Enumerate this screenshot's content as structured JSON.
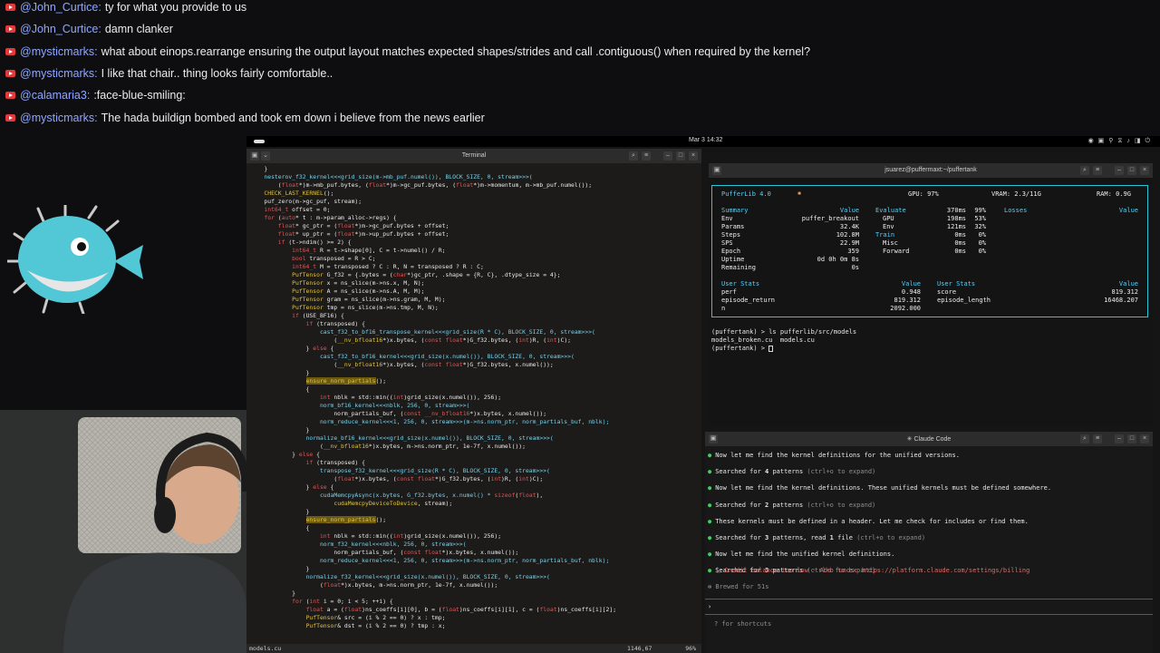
{
  "chat": [
    {
      "user": "@John_Curtice:",
      "message": "ty for what you provide to us"
    },
    {
      "user": "@John_Curtice:",
      "message": "damn clanker"
    },
    {
      "user": "@mysticmarks:",
      "message": "what about einops.rearrange ensuring the output layout matches expected shapes/strides and call .contiguous() when required by the kernel?"
    },
    {
      "user": "@mysticmarks:",
      "message": "I like that chair.. thing looks fairly comfortable.."
    },
    {
      "user": "@calamaria3:",
      "message": ":face-blue-smiling:"
    },
    {
      "user": "@mysticmarks:",
      "message": "The hada buildign bombed and took em down i believe from the news earlier"
    }
  ],
  "colors": {
    "chat_user": "#8fa7ff",
    "accent_cyan": "#29c7d9",
    "keyword": "#e05555",
    "type": "#e0c240",
    "green_dot": "#3fcf5e",
    "warn": "#e06a6a"
  },
  "topbar": {
    "clock": "Mar 3 14:32",
    "tray_icons": [
      "color-wheel-icon",
      "display-icon",
      "network-icon",
      "volume-icon",
      "battery-icon",
      "power-icon"
    ]
  },
  "editor": {
    "window_title": "Terminal",
    "status_file": "models.cu",
    "status_position": "1146,67",
    "status_percent": "96%",
    "code": [
      [
        {
          "t": "    }"
        }
      ],
      [
        {
          "t": "    "
        },
        {
          "t": "nesterov_f32_kernel<<<grid_size(m->mb_puf.numel()), BLOCK_SIZE, 0, stream>>>(",
          "c": "fn"
        }
      ],
      [
        {
          "t": "        ("
        },
        {
          "t": "float",
          "c": "kw"
        },
        {
          "t": "*)m->mb_puf.bytes, ("
        },
        {
          "t": "float",
          "c": "kw"
        },
        {
          "t": "*)m->gc_puf.bytes, ("
        },
        {
          "t": "float",
          "c": "kw"
        },
        {
          "t": "*)m->momentum, m->mb_puf.numel());"
        }
      ],
      [
        {
          "t": "    "
        },
        {
          "t": "CHECK_LAST_KERNEL",
          "c": "ty"
        },
        {
          "t": "();"
        }
      ],
      [
        {
          "t": "    puf_zero(m->gc_puf, stream);"
        }
      ],
      [
        {
          "t": "    "
        },
        {
          "t": "int64_t",
          "c": "kw"
        },
        {
          "t": " offset = 0;"
        }
      ],
      [
        {
          "t": "    "
        },
        {
          "t": "for",
          "c": "kw"
        },
        {
          "t": " ("
        },
        {
          "t": "auto",
          "c": "kw"
        },
        {
          "t": "* t : m->param_alloc->regs) {"
        }
      ],
      [
        {
          "t": "        "
        },
        {
          "t": "float",
          "c": "kw"
        },
        {
          "t": "* gc_ptr = ("
        },
        {
          "t": "float",
          "c": "kw"
        },
        {
          "t": "*)m->gc_puf.bytes + offset;"
        }
      ],
      [
        {
          "t": "        "
        },
        {
          "t": "float",
          "c": "kw"
        },
        {
          "t": "* up_ptr = ("
        },
        {
          "t": "float",
          "c": "kw"
        },
        {
          "t": "*)m->up_puf.bytes + offset;"
        }
      ],
      [
        {
          "t": "        "
        },
        {
          "t": "if",
          "c": "kw"
        },
        {
          "t": " (t->ndim() >= 2) {"
        }
      ],
      [
        {
          "t": "            "
        },
        {
          "t": "int64_t",
          "c": "kw"
        },
        {
          "t": " R = t->shape[0], C = t->numel() / R;"
        }
      ],
      [
        {
          "t": "            "
        },
        {
          "t": "bool",
          "c": "kw"
        },
        {
          "t": " transposed = R > C;"
        }
      ],
      [
        {
          "t": "            "
        },
        {
          "t": "int64_t",
          "c": "kw"
        },
        {
          "t": " M = transposed ? C : R, N = transposed ? R : C;"
        }
      ],
      [
        {
          "t": "            "
        },
        {
          "t": "PufTensor",
          "c": "ty"
        },
        {
          "t": " G_f32 = {.bytes = ("
        },
        {
          "t": "char",
          "c": "kw"
        },
        {
          "t": "*)gc_ptr, .shape = {R, C}, .dtype_size = 4};"
        }
      ],
      [
        {
          "t": "            "
        },
        {
          "t": "PufTensor",
          "c": "ty"
        },
        {
          "t": " x = ns_slice(m->ns.x, M, N);"
        }
      ],
      [
        {
          "t": "            "
        },
        {
          "t": "PufTensor",
          "c": "ty"
        },
        {
          "t": " A = ns_slice(m->ns.A, M, M);"
        }
      ],
      [
        {
          "t": "            "
        },
        {
          "t": "PufTensor",
          "c": "ty"
        },
        {
          "t": " gram = ns_slice(m->ns.gram, M, M);"
        }
      ],
      [
        {
          "t": "            "
        },
        {
          "t": "PufTensor",
          "c": "ty"
        },
        {
          "t": " tmp = ns_slice(m->ns.tmp, M, N);"
        }
      ],
      [
        {
          "t": "            "
        },
        {
          "t": "if",
          "c": "kw"
        },
        {
          "t": " (USE_BF16) {"
        }
      ],
      [
        {
          "t": "                "
        },
        {
          "t": "if",
          "c": "kw"
        },
        {
          "t": " (transposed) {"
        }
      ],
      [
        {
          "t": "                    "
        },
        {
          "t": "cast_f32_to_bf16_transpose_kernel<<<grid_size(R * C), BLOCK_SIZE, 0, stream>>>(",
          "c": "fn"
        }
      ],
      [
        {
          "t": "                        ("
        },
        {
          "t": "__nv_bfloat16",
          "c": "ty"
        },
        {
          "t": "*)x.bytes, ("
        },
        {
          "t": "const float",
          "c": "kw"
        },
        {
          "t": "*)G_f32.bytes, ("
        },
        {
          "t": "int",
          "c": "kw"
        },
        {
          "t": ")R, ("
        },
        {
          "t": "int",
          "c": "kw"
        },
        {
          "t": ")C);"
        }
      ],
      [
        {
          "t": "                } "
        },
        {
          "t": "else",
          "c": "kw"
        },
        {
          "t": " {"
        }
      ],
      [
        {
          "t": "                    "
        },
        {
          "t": "cast_f32_to_bf16_kernel<<<grid_size(x.numel()), BLOCK_SIZE, 0, stream>>>(",
          "c": "fn"
        }
      ],
      [
        {
          "t": "                        ("
        },
        {
          "t": "__nv_bfloat16",
          "c": "ty"
        },
        {
          "t": "*)x.bytes, ("
        },
        {
          "t": "const float",
          "c": "kw"
        },
        {
          "t": "*)G_f32.bytes, x.numel());"
        }
      ],
      [
        {
          "t": "                }"
        }
      ],
      [
        {
          "t": "                "
        },
        {
          "t": "ensure_norm_partials",
          "c": "hl"
        },
        {
          "t": "();"
        }
      ],
      [
        {
          "t": "                {"
        }
      ],
      [
        {
          "t": "                    "
        },
        {
          "t": "int",
          "c": "kw"
        },
        {
          "t": " nblk = std::min(("
        },
        {
          "t": "int",
          "c": "kw"
        },
        {
          "t": ")grid_size(x.numel()), 256);"
        }
      ],
      [
        {
          "t": "                    "
        },
        {
          "t": "norm_bf16_kernel<<<nblk, 256, 0, stream>>>(",
          "c": "fn"
        }
      ],
      [
        {
          "t": "                        norm_partials_buf, ("
        },
        {
          "t": "const __nv_bfloat16",
          "c": "kw"
        },
        {
          "t": "*)x.bytes, x.numel());"
        }
      ],
      [
        {
          "t": "                    "
        },
        {
          "t": "norm_reduce_kernel<<<1, 256, 0, stream>>>(m->ns.norm_ptr, norm_partials_buf, nblk);",
          "c": "fn"
        }
      ],
      [
        {
          "t": "                }"
        }
      ],
      [
        {
          "t": "                "
        },
        {
          "t": "normalize_bf16_kernel<<<grid_size(x.numel()), BLOCK_SIZE, 0, stream>>>(",
          "c": "fn"
        }
      ],
      [
        {
          "t": "                    ("
        },
        {
          "t": "__nv_bfloat16",
          "c": "ty"
        },
        {
          "t": "*)x.bytes, m->ns.norm_ptr, 1e-7f, x.numel());"
        }
      ],
      [
        {
          "t": "            } "
        },
        {
          "t": "else",
          "c": "kw"
        },
        {
          "t": " {"
        }
      ],
      [
        {
          "t": "                "
        },
        {
          "t": "if",
          "c": "kw"
        },
        {
          "t": " (transposed) {"
        }
      ],
      [
        {
          "t": "                    "
        },
        {
          "t": "transpose_f32_kernel<<<grid_size(R * C), BLOCK_SIZE, 0, stream>>>(",
          "c": "fn"
        }
      ],
      [
        {
          "t": "                        ("
        },
        {
          "t": "float",
          "c": "kw"
        },
        {
          "t": "*)x.bytes, ("
        },
        {
          "t": "const float",
          "c": "kw"
        },
        {
          "t": "*)G_f32.bytes, ("
        },
        {
          "t": "int",
          "c": "kw"
        },
        {
          "t": ")R, ("
        },
        {
          "t": "int",
          "c": "kw"
        },
        {
          "t": ")C);"
        }
      ],
      [
        {
          "t": "                } "
        },
        {
          "t": "else",
          "c": "kw"
        },
        {
          "t": " {"
        }
      ],
      [
        {
          "t": "                    "
        },
        {
          "t": "cudaMemcpyAsync(x.bytes, G_f32.bytes, x.numel() * ",
          "c": "fn"
        },
        {
          "t": "sizeof",
          "c": "kw"
        },
        {
          "t": "("
        },
        {
          "t": "float",
          "c": "kw"
        },
        {
          "t": "),"
        }
      ],
      [
        {
          "t": "                        "
        },
        {
          "t": "cudaMemcpyDeviceToDevice",
          "c": "ty"
        },
        {
          "t": ", stream);"
        }
      ],
      [
        {
          "t": "                }"
        }
      ],
      [
        {
          "t": "                "
        },
        {
          "t": "ensure_norm_partials",
          "c": "hl"
        },
        {
          "t": "();"
        }
      ],
      [
        {
          "t": "                {"
        }
      ],
      [
        {
          "t": "                    "
        },
        {
          "t": "int",
          "c": "kw"
        },
        {
          "t": " nblk = std::min(("
        },
        {
          "t": "int",
          "c": "kw"
        },
        {
          "t": ")grid_size(x.numel()), 256);"
        }
      ],
      [
        {
          "t": "                    "
        },
        {
          "t": "norm_f32_kernel<<<nblk, 256, 0, stream>>>(",
          "c": "fn"
        }
      ],
      [
        {
          "t": "                        norm_partials_buf, ("
        },
        {
          "t": "const float",
          "c": "kw"
        },
        {
          "t": "*)x.bytes, x.numel());"
        }
      ],
      [
        {
          "t": "                    "
        },
        {
          "t": "norm_reduce_kernel<<<1, 256, 0, stream>>>(m->ns.norm_ptr, norm_partials_buf, nblk);",
          "c": "fn"
        }
      ],
      [
        {
          "t": "                }"
        }
      ],
      [
        {
          "t": "                "
        },
        {
          "t": "normalize_f32_kernel<<<grid_size(x.numel()), BLOCK_SIZE, 0, stream>>>(",
          "c": "fn"
        }
      ],
      [
        {
          "t": "                    ("
        },
        {
          "t": "float",
          "c": "kw"
        },
        {
          "t": "*)x.bytes, m->ns.norm_ptr, 1e-7f, x.numel());"
        }
      ],
      [
        {
          "t": "            }"
        }
      ],
      [
        {
          "t": "            "
        },
        {
          "t": "for",
          "c": "kw"
        },
        {
          "t": " ("
        },
        {
          "t": "int",
          "c": "kw"
        },
        {
          "t": " i = 0; i < 5; ++i) {"
        }
      ],
      [
        {
          "t": "                "
        },
        {
          "t": "float",
          "c": "kw"
        },
        {
          "t": " a = ("
        },
        {
          "t": "float",
          "c": "kw"
        },
        {
          "t": ")ns_coeffs[i][0], b = ("
        },
        {
          "t": "float",
          "c": "kw"
        },
        {
          "t": ")ns_coeffs[i][1], c = ("
        },
        {
          "t": "float",
          "c": "kw"
        },
        {
          "t": ")ns_coeffs[i][2];"
        }
      ],
      [
        {
          "t": "                "
        },
        {
          "t": "PufTensor",
          "c": "ty"
        },
        {
          "t": "& src = (i % 2 == 0) ? x : tmp;"
        }
      ],
      [
        {
          "t": "                "
        },
        {
          "t": "PufTensor",
          "c": "ty"
        },
        {
          "t": "& dst = (i % 2 == 0) ? tmp : x;"
        }
      ]
    ]
  },
  "puffer": {
    "window_title": "jsuarez@puffermaxt:~/puffertank",
    "header": {
      "name": "PufferLib 4.0",
      "gpu": "GPU: 97%",
      "vram": "VRAM: 2.3/11G",
      "ram": "RAM: 0.9G"
    },
    "summary_head": {
      "label": "Summary",
      "value": "Value"
    },
    "summary": [
      {
        "k": "Env",
        "v": "puffer_breakout"
      },
      {
        "k": "Params",
        "v": "32.4K"
      },
      {
        "k": "Steps",
        "v": "102.8M"
      },
      {
        "k": "SPS",
        "v": "22.9M"
      },
      {
        "k": "Epoch",
        "v": "359"
      },
      {
        "k": "Uptime",
        "v": "0d 0h 0m 8s"
      },
      {
        "k": "Remaining",
        "v": "0s"
      }
    ],
    "perf_head": "Evaluate",
    "perf": [
      {
        "k": "GPU",
        "v": "198ms",
        "p": "53%",
        "c": "w"
      },
      {
        "k": "Env",
        "v": "121ms",
        "p": "32%",
        "c": "w"
      },
      {
        "k": "Train",
        "v": "0ms",
        "p": "0%",
        "c": "cy"
      },
      {
        "k": "Misc",
        "v": "0ms",
        "p": "0%",
        "c": "w"
      },
      {
        "k": "Forward",
        "v": "0ms",
        "p": "0%",
        "c": "w"
      }
    ],
    "evaluate_ms": "370ms",
    "evaluate_pct": "99%",
    "losses_head": {
      "label": "Losses",
      "value": "Value"
    },
    "user_stats_left_head": {
      "label": "User Stats",
      "value": "Value"
    },
    "user_stats_left": [
      {
        "k": "perf",
        "v": "0.948"
      },
      {
        "k": "episode_return",
        "v": "819.312"
      },
      {
        "k": "n",
        "v": "2092.000"
      }
    ],
    "user_stats_right_head": {
      "label": "User Stats",
      "value": "Value"
    },
    "user_stats_right": [
      {
        "k": "score",
        "v": "819.312"
      },
      {
        "k": "episode_length",
        "v": "16468.207"
      }
    ],
    "shell": [
      "(puffertank) > ls pufferlib/src/models",
      "models_broken.cu  models.cu",
      "(puffertank) > "
    ]
  },
  "claude": {
    "window_title": "✳ Claude Code",
    "lines": [
      {
        "segs": [
          {
            "t": "Now let me find the kernel definitions for the unified versions."
          }
        ]
      },
      {
        "segs": [
          {
            "t": "Searched for ",
            "c": ""
          },
          {
            "t": "4",
            "c": "bold"
          },
          {
            "t": " patterns ",
            "c": ""
          },
          {
            "t": "(ctrl+o to expand)",
            "c": "dim"
          }
        ]
      },
      {
        "segs": [
          {
            "t": "Now let me find the kernel definitions. These unified kernels must be defined somewhere."
          }
        ]
      },
      {
        "segs": [
          {
            "t": "Searched for ",
            "c": ""
          },
          {
            "t": "2",
            "c": "bold"
          },
          {
            "t": " patterns ",
            "c": ""
          },
          {
            "t": "(ctrl+o to expand)",
            "c": "dim"
          }
        ]
      },
      {
        "segs": [
          {
            "t": "These kernels must be defined in a header. Let me check for includes or find them."
          }
        ]
      },
      {
        "segs": [
          {
            "t": "Searched for ",
            "c": ""
          },
          {
            "t": "3",
            "c": "bold"
          },
          {
            "t": " patterns, read ",
            "c": ""
          },
          {
            "t": "1",
            "c": "bold"
          },
          {
            "t": " file ",
            "c": ""
          },
          {
            "t": "(ctrl+o to expand)",
            "c": "dim"
          }
        ]
      },
      {
        "segs": [
          {
            "t": "Now let me find the unified kernel definitions."
          }
        ]
      },
      {
        "segs": [
          {
            "t": "Searched for ",
            "c": ""
          },
          {
            "t": "3",
            "c": "bold"
          },
          {
            "t": " patterns ",
            "c": ""
          },
          {
            "t": "(ctrl+o to expand)",
            "c": "dim"
          }
        ]
      }
    ],
    "error": "⎿  Credit balance too low · Add funds: https://platform.claude.com/settings/billing",
    "brewed": "✻ Brewed for 51s",
    "prompt": "›",
    "hint": "? for shortcuts"
  }
}
